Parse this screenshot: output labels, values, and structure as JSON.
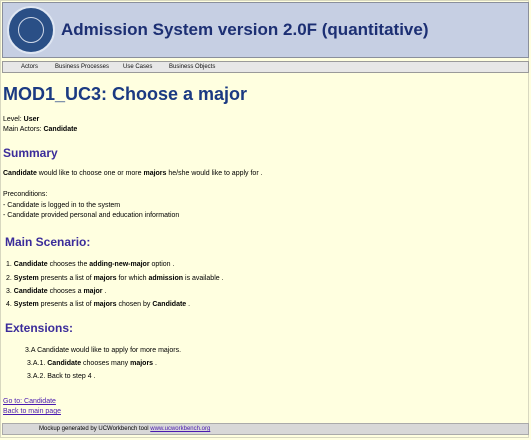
{
  "header": {
    "title": "Admission System version 2.0F (quantitative)",
    "logo_icon": "university-seal-icon"
  },
  "nav": {
    "items": [
      "Actors",
      "Business Processes",
      "Use Cases",
      "Business Objects"
    ]
  },
  "page": {
    "title": "MOD1_UC3: Choose a major",
    "level_label": "Level:",
    "level_value": "User",
    "actors_label": "Main Actors:",
    "actors_value": "Candidate"
  },
  "summary": {
    "heading": "Summary",
    "text_actor": "Candidate",
    "text_mid": " would like to choose one or more ",
    "text_majors": "majors",
    "text_end": " he/she would like to apply for .",
    "preconditions_label": "Preconditions:",
    "preconditions": [
      "- Candidate is logged in to the system",
      "- Candidate provided personal and education information"
    ]
  },
  "main_scenario": {
    "heading": "Main Scenario:",
    "steps": [
      {
        "num": "1.",
        "actor": "Candidate",
        "mid": " chooses the ",
        "obj": "adding-new-major",
        "end": " option ."
      },
      {
        "num": "2.",
        "actor": "System",
        "mid": " presents a list of ",
        "obj": "majors",
        "mid2": " for which ",
        "obj2": "admission",
        "end": " is available ."
      },
      {
        "num": "3.",
        "actor": "Candidate",
        "mid": " chooses a ",
        "obj": "major",
        "end": " ."
      },
      {
        "num": "4.",
        "actor": "System",
        "mid": " presents a list of ",
        "obj": "majors",
        "mid2": " chosen by ",
        "obj2": "Candidate",
        "end": " ."
      }
    ]
  },
  "extensions": {
    "heading": "Extensions:",
    "e1": "3.A Candidate would like to apply for more majors.",
    "e2_num": "3.A.1.",
    "e2_actor": "Candidate",
    "e2_mid": " chooses many ",
    "e2_obj": "majors",
    "e2_end": " .",
    "e3": "3.A.2. Back to step 4 ."
  },
  "links": {
    "goto": "Go to: Candidate",
    "back": "Back to main page"
  },
  "footer": {
    "text": "Mockup generated by UCWorkbench tool ",
    "link": "www.ucworkbench.org"
  },
  "colors": {
    "background": "#ffffe0",
    "header_bg": "#c6cfe3",
    "title_blue": "#1b3a82",
    "section_purple": "#3b2c9a",
    "link_purple": "#4a1ab0"
  }
}
